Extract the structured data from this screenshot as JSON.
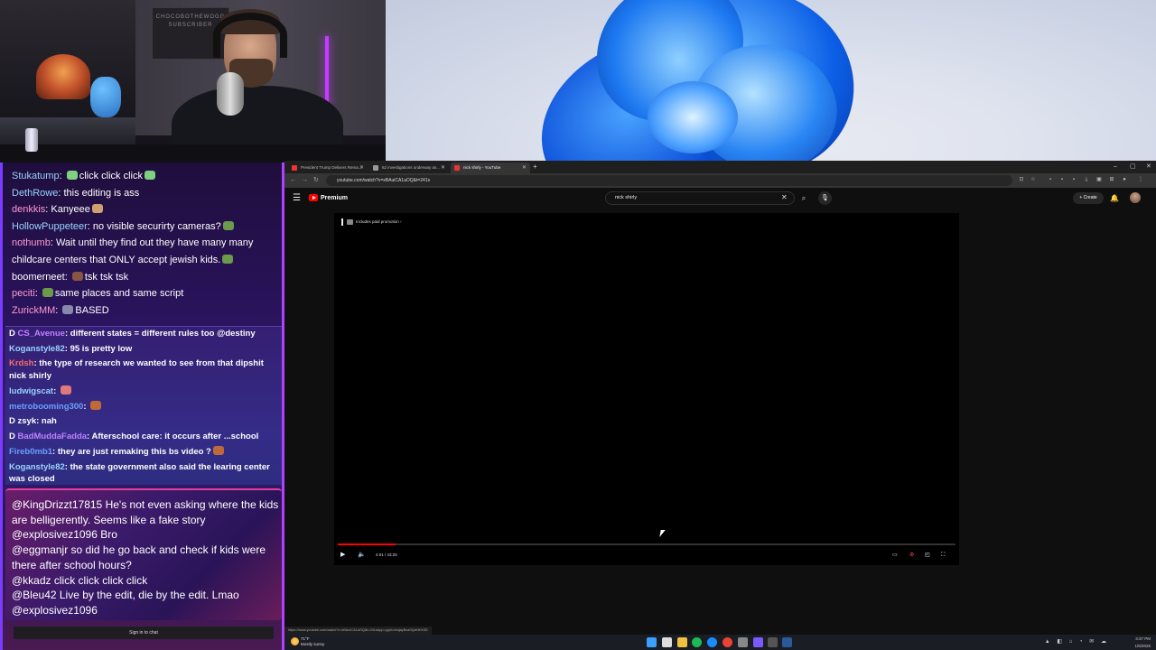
{
  "webcam": {
    "poster_text": "CHOCOBOTHEWOGG SUBSCRIBER"
  },
  "chat_top": {
    "messages": [
      {
        "user": "Stukatump",
        "color": "#9ad2ff",
        "text": "click click click",
        "emoji_color": "#7fd07f"
      },
      {
        "user": "DethRowe",
        "color": "#9ad2ff",
        "text": "this editing is ass"
      },
      {
        "user": "denkkis",
        "color": "#ff9ad2",
        "text": "Kanyeee",
        "emoji_color": "#d0a070"
      },
      {
        "user": "HollowPuppeteer",
        "color": "#9ad2ff",
        "text": "no visible securirty cameras?",
        "emoji_color": "#6a9a4a"
      },
      {
        "user": "nothumb",
        "color": "#ff9ad2",
        "text": "Wait until they find out they have many many"
      },
      {
        "user": "",
        "color": "#ffffff",
        "text": "childcare centers that ONLY accept jewish kids.",
        "emoji_color": "#6a9a4a"
      },
      {
        "user": "boomerneet",
        "color": "#ffffff",
        "text": "tsk tsk tsk",
        "emoji_color": "#885544"
      },
      {
        "user": "peciti",
        "color": "#ff9ad2",
        "text": "same places and same script",
        "emoji_color": "#6a9a4a"
      },
      {
        "user": "ZurickMM",
        "color": "#ff9ad2",
        "text": "BASED",
        "emoji_color": "#8888aa"
      }
    ]
  },
  "chat_mid": {
    "messages": [
      {
        "user": "CS_Avenue",
        "color": "#c080ff",
        "text": "different states = different rules too @destiny",
        "badge": "D"
      },
      {
        "user": "Koganstyle82",
        "color": "#9ad2ff",
        "text": "95 is pretty low"
      },
      {
        "user": "Krdsh",
        "color": "#ff6a6a",
        "text": "the type of research we wanted to see from that dipshit nick shirly",
        "wrap": true
      },
      {
        "user": "ludwigscat",
        "color": "#9ad2ff",
        "text": "",
        "emoji_color": "#e07a7a"
      },
      {
        "user": "metrobooming300",
        "color": "#6aa0ff",
        "text": "",
        "emoji_color": "#c06a3a"
      },
      {
        "user": "zsyk",
        "color": "#ffffff",
        "text": "nah",
        "badge": "D"
      },
      {
        "user": "BadMuddaFadda",
        "color": "#c080ff",
        "text": "Afterschool care: it occurs after ...school",
        "badge": "D"
      },
      {
        "user": "Fireb0mb1",
        "color": "#6aa0ff",
        "text": "they are just remaking this bs video ?",
        "emoji_color": "#c06a3a"
      },
      {
        "user": "Koganstyle82",
        "color": "#9ad2ff",
        "text": "the state government also said the learing center was closed",
        "wrap": true
      }
    ]
  },
  "chat_bottom": {
    "messages": [
      "@KingDrizzt17815 He's not even asking where the kids are belligerently. Seems like a fake story",
      "@explosivez1096 Bro",
      "@eggmanjr so did he go back and check if kids were there after school hours?",
      "@kkadz click click click click",
      "@Bleu42 Live by the edit, die by the edit. Lmao",
      "@explosivez1096"
    ],
    "sign_in": "Sign in to chat"
  },
  "browser": {
    "tabs": [
      {
        "title": "President Trump Delivers Rema..."
      },
      {
        "title": "62 investigations underway as..."
      },
      {
        "title": "nick shirly - YouTube",
        "active": true
      }
    ],
    "new_tab": "+",
    "url": "youtube.com/watch?v=xBAuiCA1aOQ&t=241s",
    "status_url": "https://www.youtube.com/watch?v=xBAuiCA1aOQ&t=241s&pp=ygULbmljayBzaGlybHk%3D"
  },
  "youtube": {
    "brand": "Premium",
    "search_value": "nick shirly",
    "create_label": "Create",
    "paid_promotion": "Includes paid promotion",
    "time": "4:01 / 43:25",
    "progress_fraction": 0.093
  },
  "taskbar": {
    "temp": "71°F",
    "weather": "Mostly sunny",
    "time": "3:37 PM",
    "date": "1/6/2026"
  }
}
